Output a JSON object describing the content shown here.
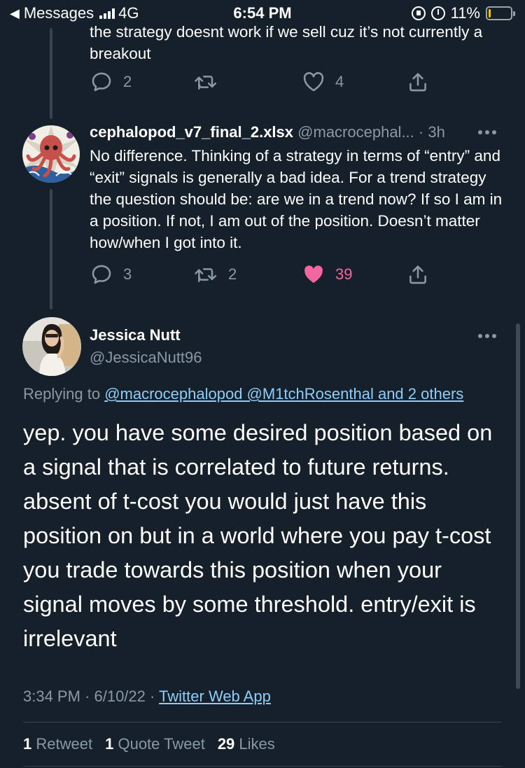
{
  "status_bar": {
    "back_app": "Messages",
    "network": "4G",
    "time": "6:54 PM",
    "battery": "11%",
    "battery_level": 0.11
  },
  "prev_tweet": {
    "text": "the strategy doesnt work if we sell cuz it’s not currently a breakout",
    "replies": "2",
    "retweets": "",
    "likes": "4"
  },
  "reply_tweet": {
    "name": "cephalopod_v7_final_2.xlsx",
    "handle": "@macrocephal...",
    "time": "· 3h",
    "text": "No difference. Thinking of a strategy in terms of “entry” and “exit” signals is generally a bad idea. For a trend strategy the question should be: are we in a trend now? If so I am in a position. If not, I am out of the position. Doesn’t matter how/when I got into it.",
    "replies": "3",
    "retweets": "2",
    "likes": "39",
    "liked": true
  },
  "main_tweet": {
    "name": "Jessica Nutt",
    "handle": "@JessicaNutt96",
    "replying_prefix": "Replying to",
    "replying_to": "@macrocephalopod @M1tchRosenthal and 2 others",
    "text": "yep. you have some desired position based on a signal that is correlated to future returns. absent of t-cost you would just have this position on but in a world where you pay t-cost you trade towards this position when your signal moves by some threshold. entry/exit is irrelevant",
    "timestamp": "3:34 PM · 6/10/22 ·",
    "source": "Twitter Web App",
    "retweets_count": "1",
    "retweets_label": "Retweet",
    "quotes_count": "1",
    "quotes_label": "Quote Tweet",
    "likes_count": "29",
    "likes_label": "Likes"
  },
  "colors": {
    "background": "#15202b",
    "secondary_text": "#8899a6",
    "link": "#8ecdf8",
    "like_pink": "#f91880",
    "divider": "#38444d"
  }
}
